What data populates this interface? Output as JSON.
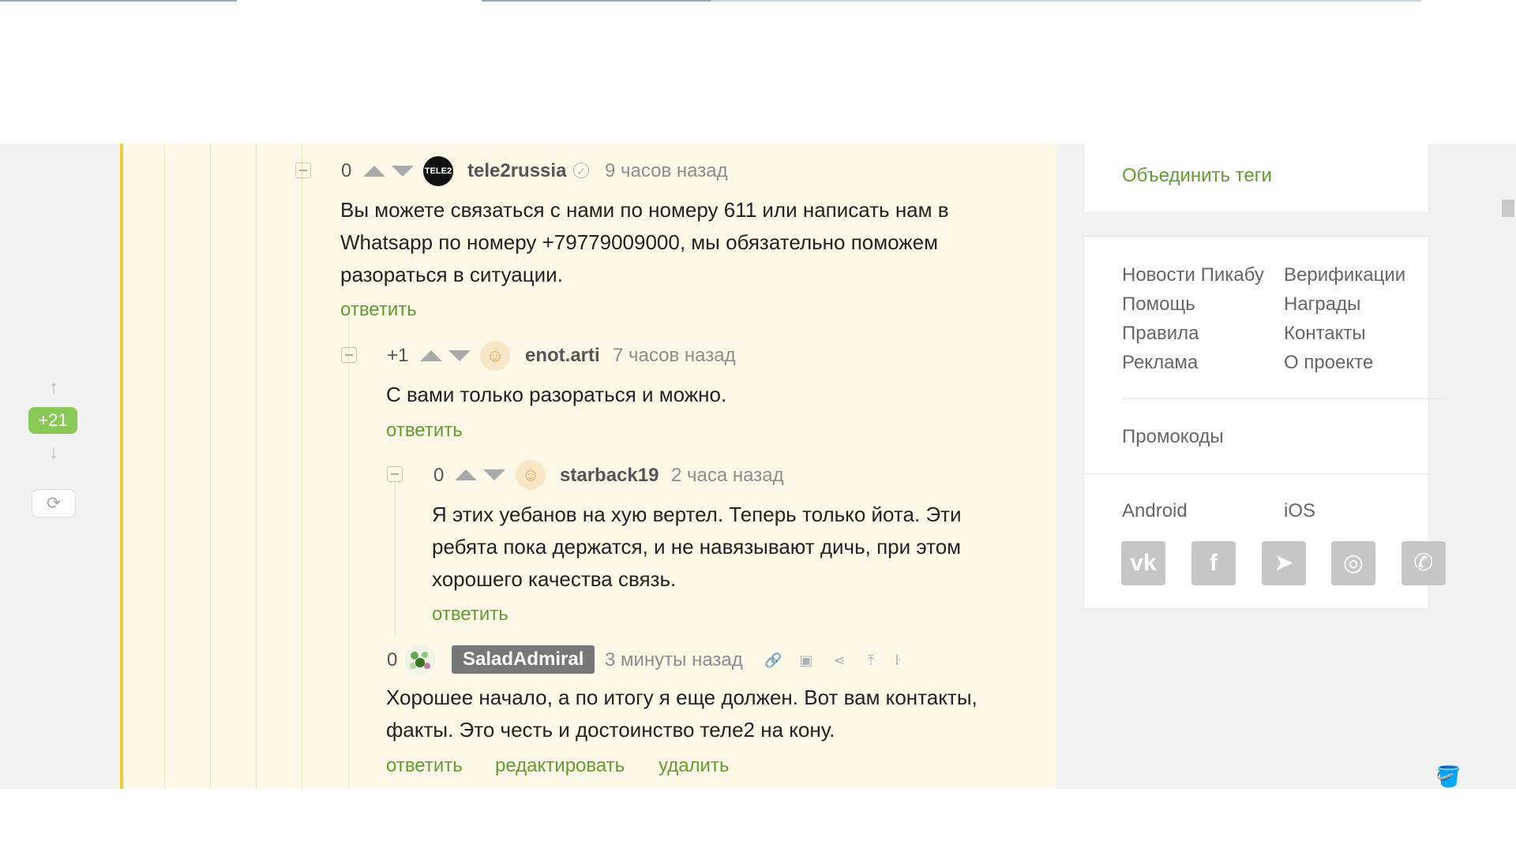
{
  "rail": {
    "rating": "+21",
    "up_icon": "arrow-up-icon",
    "down_icon": "arrow-down-icon",
    "refresh_icon": "refresh-icon"
  },
  "comments": [
    {
      "score": "0",
      "user": "tele2russia",
      "avatar_text": "TELE2",
      "time": "9 часов назад",
      "lines": [
        "Вы можете связаться с нами по номеру 611 или написать нам в",
        "Whatsapp по номеру +79779009000, мы обязательно поможем",
        "разораться в ситуации."
      ],
      "reply": "ответить"
    },
    {
      "score": "+1",
      "user": "enot.arti",
      "time": "7 часов назад",
      "lines": [
        "С вами только разораться и можно."
      ],
      "reply": "ответить"
    },
    {
      "score": "0",
      "user": "starback19",
      "time": "2 часа назад",
      "lines": [
        "Я этих уебанов на хую вертел. Теперь только йота. Эти",
        "ребята пока держатся, и не навязывают дичь, при этом",
        "хорошего качества связь."
      ],
      "reply": "ответить"
    },
    {
      "score": "0",
      "user": "SaladAdmiral",
      "time": "3 минуты назад",
      "lines": [
        "Хорошее начало, а по итогу я еще должен. Вот вам контакты,",
        "факты. Это честь и достоинство теле2 на кону."
      ],
      "reply": "ответить",
      "edit": "редактировать",
      "delete": "удалить"
    }
  ],
  "sidebar": {
    "merge_tags": "Объединить теги",
    "links_left": [
      "Новости Пикабу",
      "Помощь",
      "Правила",
      "Реклама"
    ],
    "links_right": [
      "Верификации",
      "Награды",
      "Контакты",
      "О проекте"
    ],
    "promo": "Промокоды",
    "android": "Android",
    "ios": "iOS",
    "social": [
      {
        "name": "vk-icon",
        "glyph": "vk"
      },
      {
        "name": "facebook-icon",
        "glyph": "f"
      },
      {
        "name": "telegram-icon",
        "glyph": "➤"
      },
      {
        "name": "instagram-icon",
        "glyph": "◎"
      },
      {
        "name": "viber-icon",
        "glyph": "✆"
      }
    ]
  },
  "colors": {
    "accent_green": "#5f9d2f",
    "rating_green": "#8ac858",
    "thread_bg": "#fdf8e8",
    "thread_bar": "#f2cc3a"
  }
}
